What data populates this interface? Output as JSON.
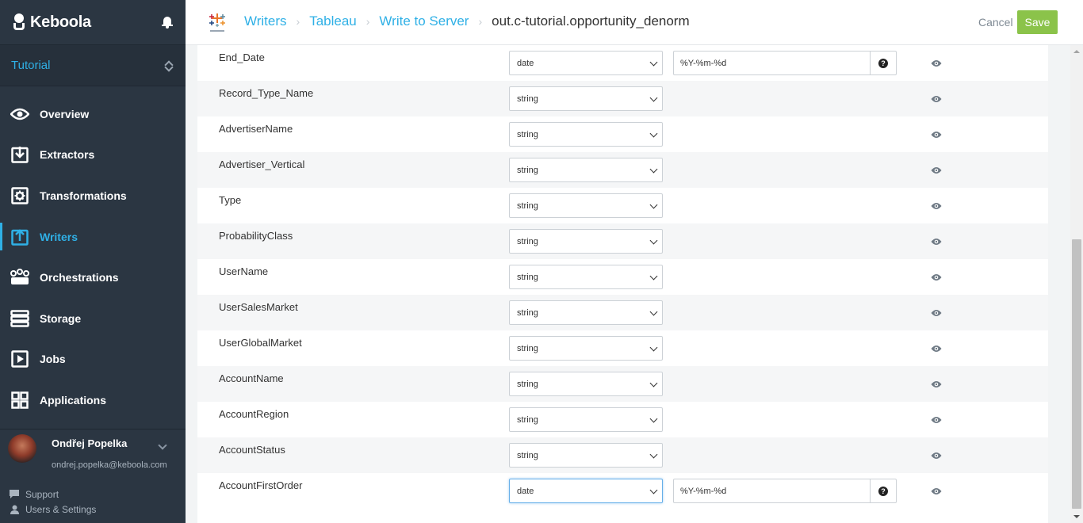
{
  "app": {
    "name": "Keboola"
  },
  "sidebar": {
    "project": "Tutorial",
    "items": [
      {
        "label": "Overview",
        "icon": "eye-icon",
        "active": false
      },
      {
        "label": "Extractors",
        "icon": "download-box-icon",
        "active": false
      },
      {
        "label": "Transformations",
        "icon": "gear-box-icon",
        "active": false
      },
      {
        "label": "Writers",
        "icon": "upload-box-icon",
        "active": true
      },
      {
        "label": "Orchestrations",
        "icon": "cluster-icon",
        "active": false
      },
      {
        "label": "Storage",
        "icon": "database-icon",
        "active": false
      },
      {
        "label": "Jobs",
        "icon": "play-box-icon",
        "active": false
      },
      {
        "label": "Applications",
        "icon": "grid-icon",
        "active": false
      }
    ],
    "user": {
      "name": "Ondřej Popelka",
      "email": "ondrej.popelka@keboola.com"
    },
    "footer": {
      "support": "Support",
      "settings": "Users & Settings"
    }
  },
  "header": {
    "breadcrumbs": [
      "Writers",
      "Tableau",
      "Write to Server"
    ],
    "current": "out.c-tutorial.opportunity_denorm",
    "cancel": "Cancel",
    "save": "Save"
  },
  "columns": [
    {
      "name": "End_Date",
      "type": "date",
      "format": "%Y-%m-%d"
    },
    {
      "name": "Record_Type_Name",
      "type": "string"
    },
    {
      "name": "AdvertiserName",
      "type": "string"
    },
    {
      "name": "Advertiser_Vertical",
      "type": "string"
    },
    {
      "name": "Type",
      "type": "string"
    },
    {
      "name": "ProbabilityClass",
      "type": "string"
    },
    {
      "name": "UserName",
      "type": "string"
    },
    {
      "name": "UserSalesMarket",
      "type": "string"
    },
    {
      "name": "UserGlobalMarket",
      "type": "string"
    },
    {
      "name": "AccountName",
      "type": "string"
    },
    {
      "name": "AccountRegion",
      "type": "string"
    },
    {
      "name": "AccountStatus",
      "type": "string"
    },
    {
      "name": "AccountFirstOrder",
      "type": "date",
      "format": "%Y-%m-%d",
      "focused": true
    }
  ],
  "colors": {
    "accent": "#2fb0e6",
    "save": "#8bc34a",
    "sidebar": "#2b3642"
  }
}
